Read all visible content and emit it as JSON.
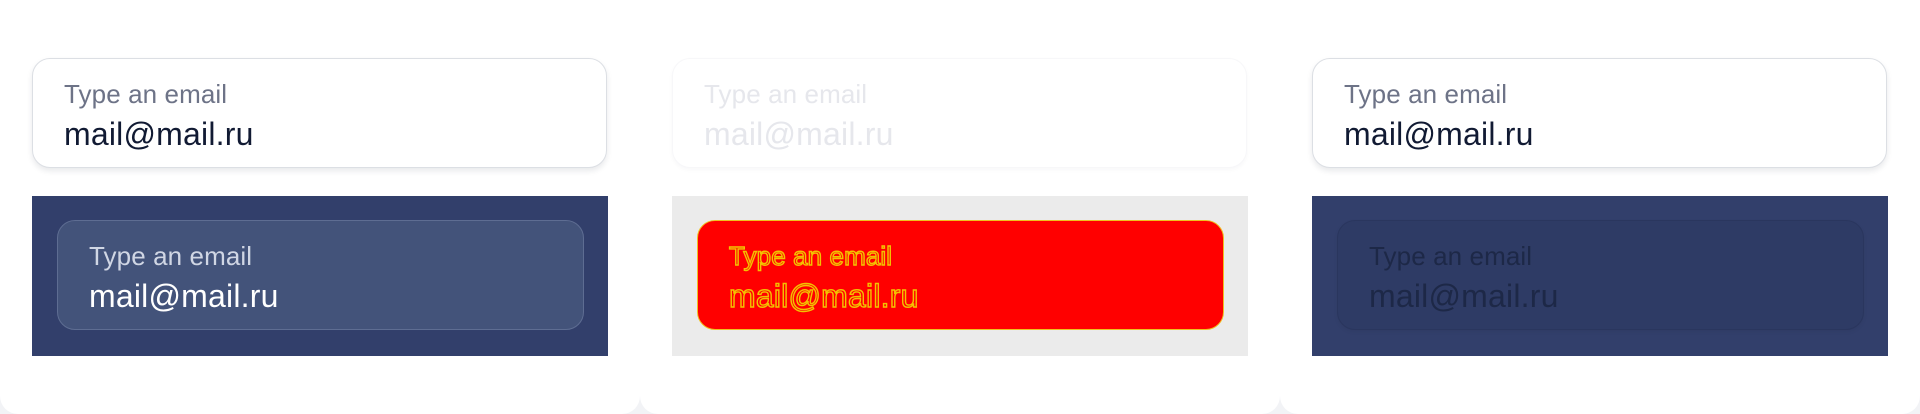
{
  "colors": {
    "panel_bg": "#ffffff",
    "dark_bg": "#323f6b",
    "grey_bg": "#ebebeb",
    "error_fill": "#ff0000",
    "error_outline": "#f3c200"
  },
  "panels": [
    {
      "top_field": {
        "label": "Type an email",
        "value": "mail@mail.ru",
        "state": "default"
      },
      "bottom_field": {
        "label": "Type an email",
        "value": "mail@mail.ru",
        "state": "dark-default"
      }
    },
    {
      "top_field": {
        "label": "Type an email",
        "value": "mail@mail.ru",
        "state": "disabled"
      },
      "bottom_field": {
        "label": "Type an email",
        "value": "mail@mail.ru",
        "state": "error-highlight"
      }
    },
    {
      "top_field": {
        "label": "Type an email",
        "value": "mail@mail.ru",
        "state": "default"
      },
      "bottom_field": {
        "label": "Type an email",
        "value": "mail@mail.ru",
        "state": "dark-disabled"
      }
    }
  ]
}
